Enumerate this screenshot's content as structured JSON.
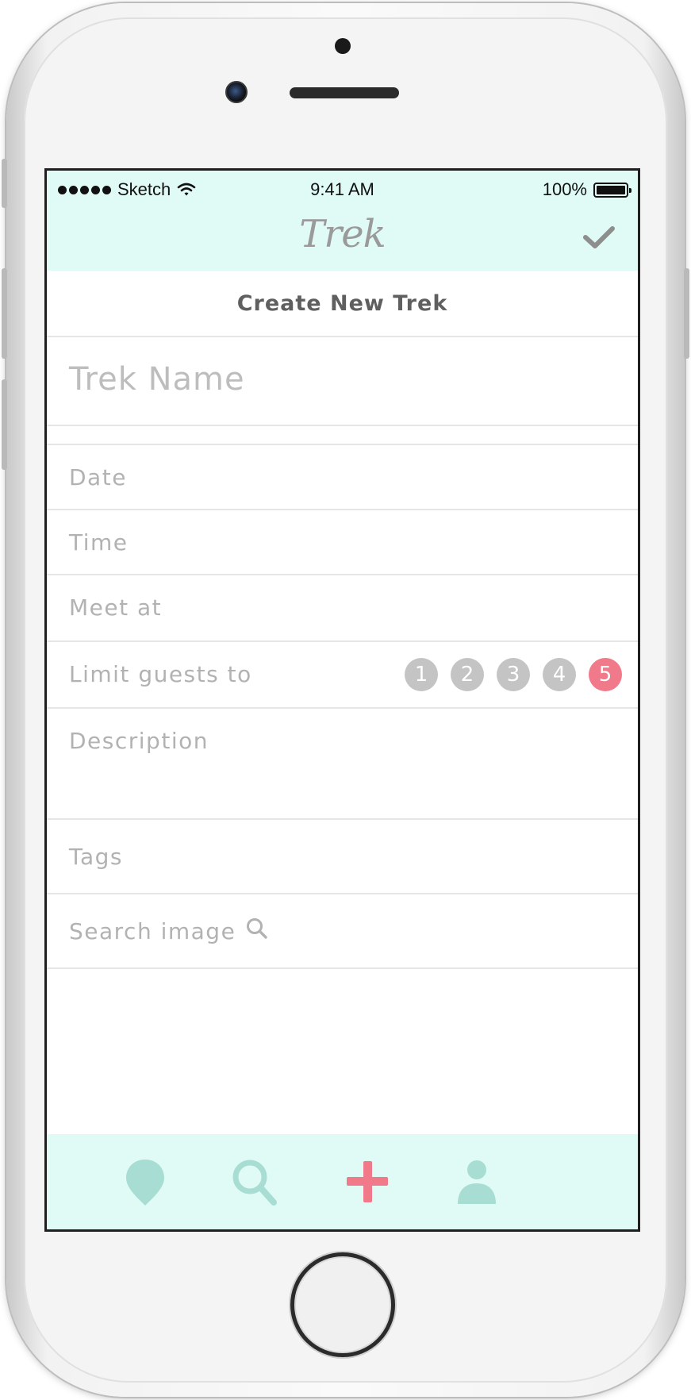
{
  "status_bar": {
    "carrier": "Sketch",
    "time": "9:41 AM",
    "battery": "100%"
  },
  "nav": {
    "brand": "Trek",
    "confirm_icon": "checkmark-icon"
  },
  "page_title": "Create New Trek",
  "form": {
    "trek_name_placeholder": "Trek Name",
    "date_label": "Date",
    "time_label": "Time",
    "meet_label": "Meet at",
    "limit_label": "Limit guests to",
    "guest_options": [
      "1",
      "2",
      "3",
      "4",
      "5"
    ],
    "selected_guests": "5",
    "description_label": "Description",
    "tags_label": "Tags",
    "search_image_label": "Search image"
  },
  "tab_bar": {
    "tabs": [
      {
        "icon": "map-pin-icon"
      },
      {
        "icon": "search-icon"
      },
      {
        "icon": "plus-icon",
        "active": true
      },
      {
        "icon": "user-icon"
      }
    ]
  },
  "colors": {
    "header_bg": "#e0fbf6",
    "accent_pink": "#f0798a",
    "teal_icon": "#a8ddd3",
    "placeholder_gray": "#b2b2b2"
  }
}
